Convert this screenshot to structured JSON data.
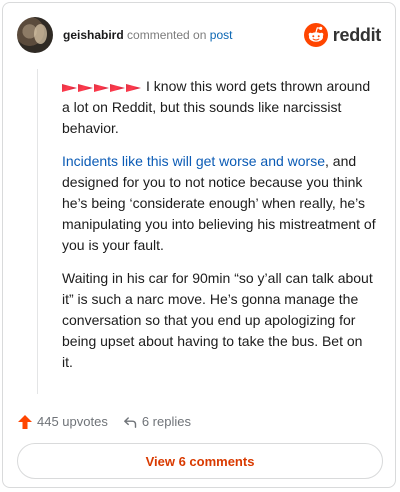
{
  "header": {
    "username": "geishabird",
    "commented_on": "commented on",
    "post": "post",
    "brand": "reddit"
  },
  "comment": {
    "paragraph_1": "I know this word gets thrown around a lot on Reddit, but this sounds like narcissist behavior.",
    "paragraph_2_link": "Incidents like this will get worse and worse",
    "paragraph_2_rest": ", and designed for you to not notice because you think he’s being ‘considerate enough’ when really, he’s manipulating you into believing his mistreatment of you is your fault.",
    "paragraph_3": "Waiting in his car for 90min “so y’all can talk about it” is such a narc move. He’s gonna manage the conversation so that you end up apologizing for being upset about having to take the bus. Bet on it."
  },
  "footer": {
    "upvotes": "445 upvotes",
    "replies": "6 replies",
    "view_comments": "View 6 comments"
  },
  "colors": {
    "reddit_orange": "#ff4500",
    "link_blue": "#0b5bb5",
    "button_text": "#d93a00"
  },
  "icons": {
    "brand": "reddit-alien-icon",
    "upvote": "upvote-arrow-icon",
    "reply": "reply-arrow-icon",
    "flags": "red-flag-emoji-icon"
  }
}
